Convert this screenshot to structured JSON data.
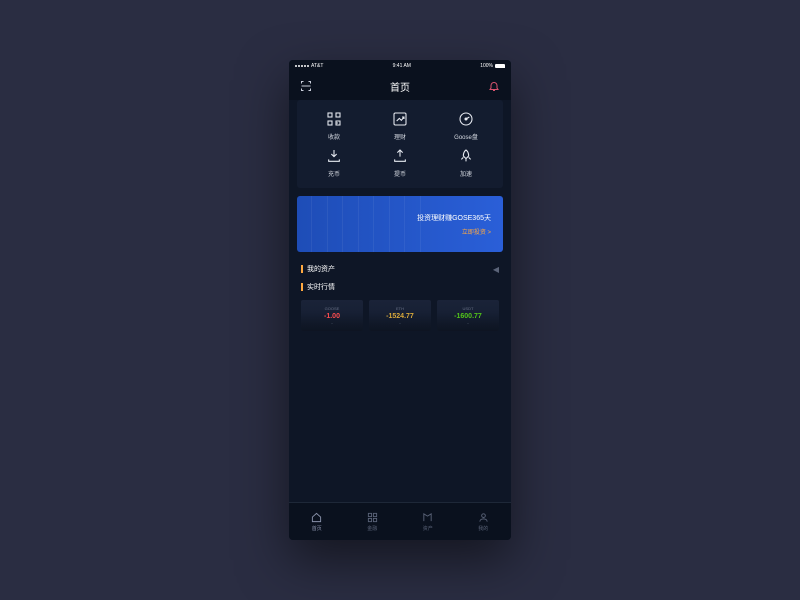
{
  "status": {
    "carrier": "AT&T",
    "time": "9:41 AM",
    "battery": "100%"
  },
  "nav": {
    "title": "首页"
  },
  "grid": [
    {
      "label": "收款",
      "icon": "qr-icon"
    },
    {
      "label": "理财",
      "icon": "chart-up-icon"
    },
    {
      "label": "Goose盘",
      "icon": "gauge-icon"
    },
    {
      "label": "充币",
      "icon": "deposit-icon"
    },
    {
      "label": "提币",
      "icon": "withdraw-icon"
    },
    {
      "label": "加速",
      "icon": "rocket-icon"
    }
  ],
  "promo": {
    "title": "投资理财赚GOSE365天",
    "cta": "立即投资 >"
  },
  "sections": {
    "assets": "我的资产",
    "quotes": "实时行情"
  },
  "quotes": [
    {
      "name": "GOOSE",
      "value": "-1.00",
      "cls": "down",
      "sub": "--"
    },
    {
      "name": "ETH",
      "value": "-1524.77",
      "cls": "mix",
      "sub": "--"
    },
    {
      "name": "USDT",
      "value": "-1600.77",
      "cls": "up",
      "sub": "--"
    }
  ],
  "tabs": [
    {
      "label": "首页",
      "icon": "home-icon",
      "active": true
    },
    {
      "label": "金融",
      "icon": "apps-icon",
      "active": false
    },
    {
      "label": "资产",
      "icon": "wallet-icon",
      "active": false
    },
    {
      "label": "我的",
      "icon": "user-icon",
      "active": false
    }
  ]
}
